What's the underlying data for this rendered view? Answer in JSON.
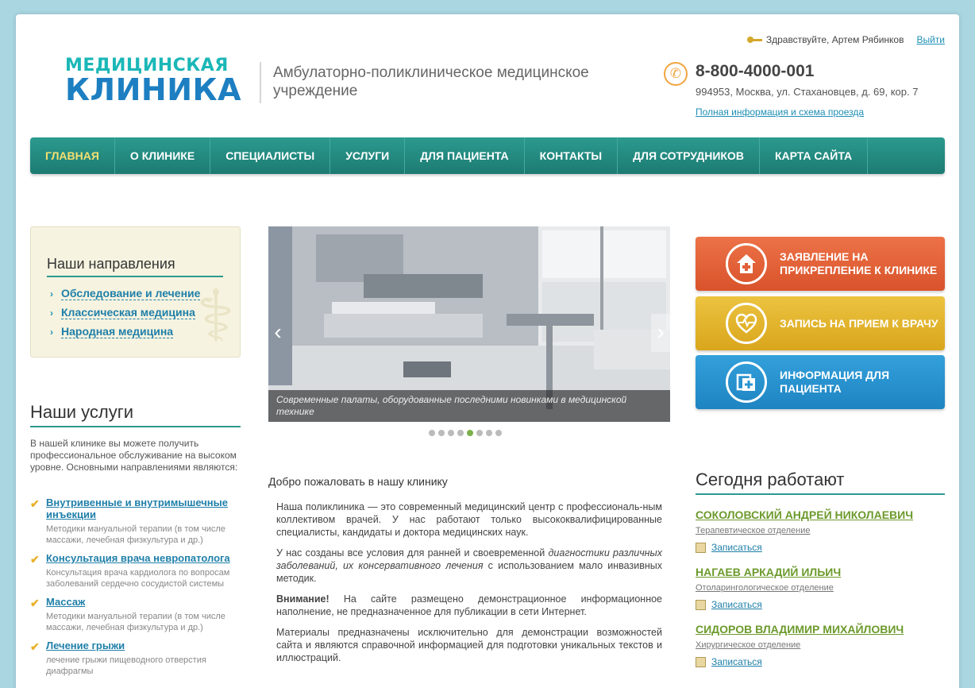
{
  "header": {
    "greeting": "Здравствуйте, Артем Рябинков",
    "logout": "Выйти",
    "logo_top": "МЕДИЦИНСКАЯ",
    "logo_bottom": "КЛИНИКА",
    "tagline": "Амбулаторно-поликлиническое медицинское учреждение",
    "phone": "8-800-4000-001",
    "address": "994953, Москва, ул. Стахановцев, д. 69, кор. 7",
    "full_info": "Полная информация и схема проезда"
  },
  "nav": [
    "Главная",
    "О клинике",
    "Специалисты",
    "Услуги",
    "Для пациента",
    "Контакты",
    "Для сотрудников",
    "Карта сайта"
  ],
  "directions": {
    "title": "Наши направления",
    "items": [
      "Обследование и лечение",
      "Классическая медицина",
      "Народная медицина"
    ]
  },
  "services": {
    "title": "Наши услуги",
    "intro": "В нашей клинике вы можете получить профессиональное обслуживание на высоком уровне. Основными направлениями являются:",
    "items": [
      {
        "name": "Внутривенные и внутримышечные инъекции",
        "desc": "Методики мануальной терапии (в том числе массажи, лечебная физкультура и др.)"
      },
      {
        "name": "Консультация врача невропатолога",
        "desc": "Консультация врача кардиолога по вопросам заболеваний сердечно сосудистой системы"
      },
      {
        "name": "Массаж",
        "desc": "Методики мануальной терапии (в том числе массажи, лечебная физкультура и др.)"
      },
      {
        "name": "Лечение грыжи",
        "desc": "лечение грыжи пищеводного отверстия диафрагмы"
      }
    ]
  },
  "slider": {
    "caption": "Современные палаты, оборудованные последними новинками в медицинской технике",
    "dots_total": 8,
    "active_dot": 4
  },
  "welcome": {
    "title": "Добро пожаловать в нашу клинику",
    "p1": "Наша поликлиника — это современный медицинский центр с профессиональ-ным коллективом врачей. У нас работают только высококвалифицированные специалисты, кандидаты и доктора медицинских наук.",
    "p2_a": "У нас созданы все условия для ранней и своевременной ",
    "p2_em": "диагностики различных заболеваний, их консервативного лечения",
    "p2_b": " с использованием мало инвазивных методик.",
    "p3_strong": "Внимание!",
    "p3": " На сайте размещено демонстрационное информационное наполнение, не предназначенное для публикации в сети Интернет.",
    "p4": "Материалы предназначены исключительно для демонстрации возможностей сайта и являются справочной информацией для подготовки уникальных текстов и иллюстраций."
  },
  "buttons": [
    {
      "label": "Заявление на прикрепление к клинике",
      "icon": "house-cross-icon",
      "color": "#e0603a"
    },
    {
      "label": "Запись на прием к врачу",
      "icon": "heart-pulse-icon",
      "color": "#e2b52e"
    },
    {
      "label": "Информация для пациента",
      "icon": "folder-cross-icon",
      "color": "#2a94d1"
    }
  ],
  "today": {
    "title": "Сегодня работают",
    "doctors": [
      {
        "name": "СОКОЛОВСКИЙ АНДРЕЙ НИКОЛАЕВИЧ",
        "dept": "Терапевтическое отделение",
        "book": "Записаться"
      },
      {
        "name": "НАГАЕВ АРКАДИЙ ИЛЬИЧ",
        "dept": "Отоларингологическое отделение",
        "book": "Записаться"
      },
      {
        "name": "СИДОРОВ ВЛАДИМИР МИХАЙЛОВИЧ",
        "dept": "Хирургическое отделение",
        "book": "Записаться"
      }
    ]
  }
}
